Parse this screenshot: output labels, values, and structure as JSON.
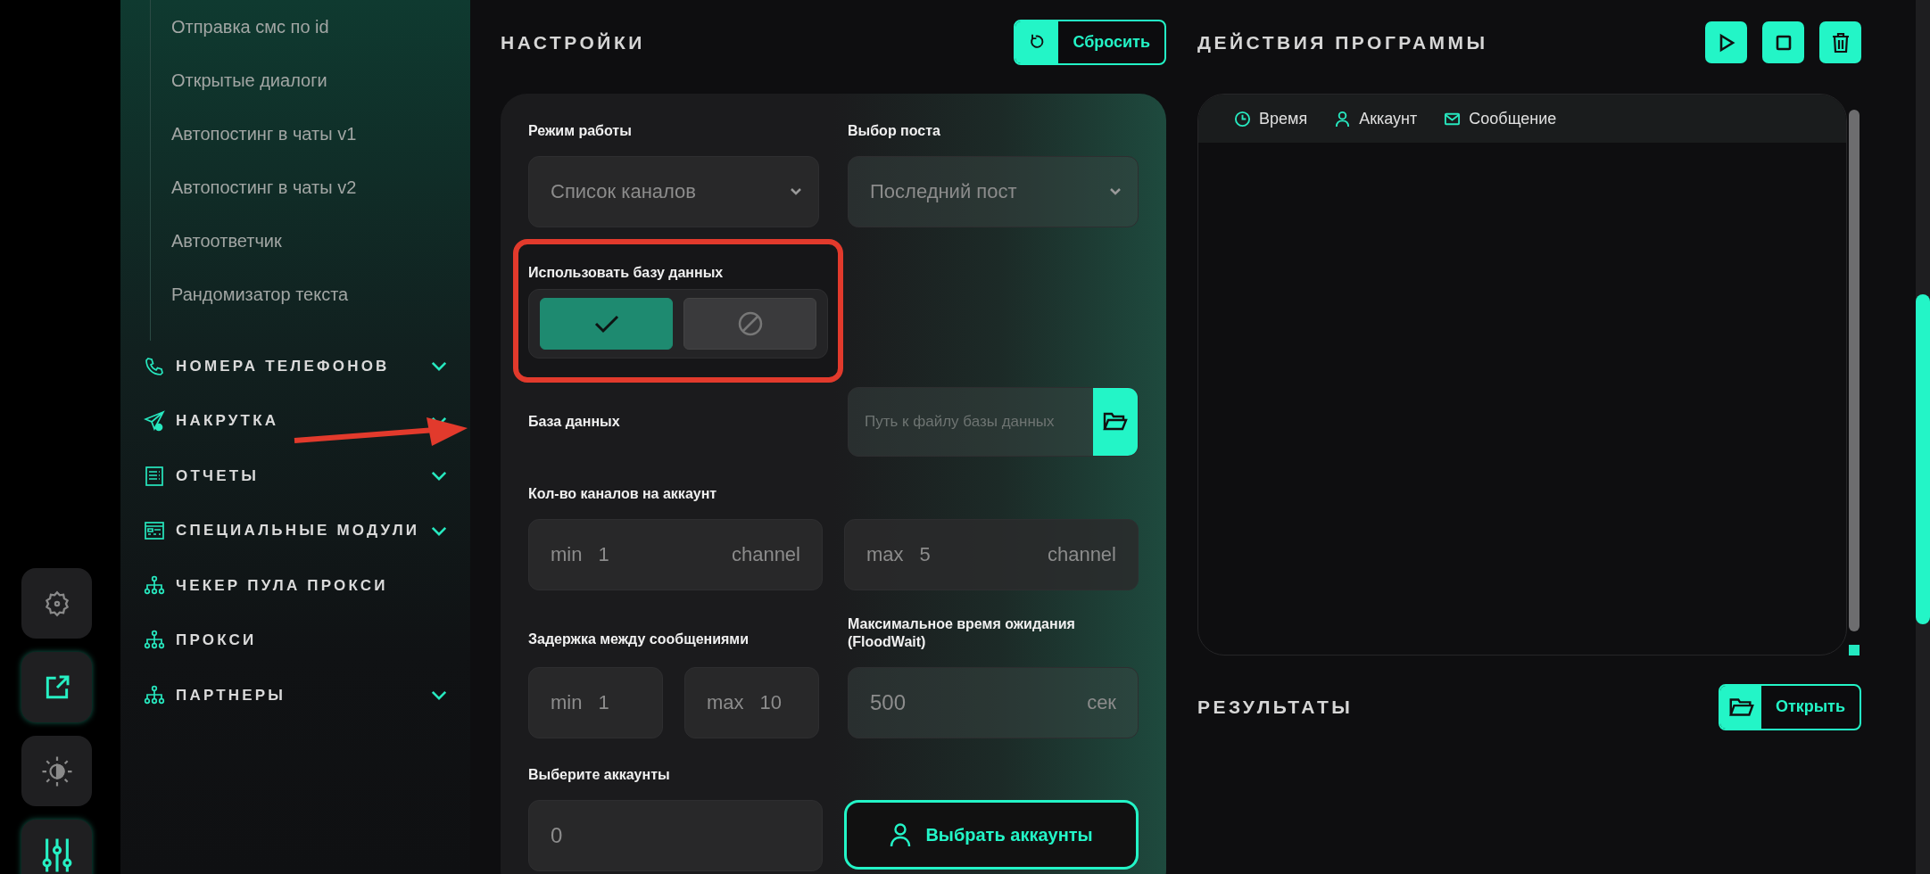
{
  "rail": [
    {
      "kind": "gear",
      "selected": false
    },
    {
      "kind": "share",
      "selected": true
    },
    {
      "kind": "theme",
      "selected": false
    },
    {
      "kind": "sliders",
      "selected": true
    }
  ],
  "sidebar": {
    "subitems": [
      "Отправка смс по id",
      "Открытые диалоги",
      "Автопостинг в чаты v1",
      "Автопостинг в чаты v2",
      "Автоответчик",
      "Рандомизатор текста"
    ],
    "sections": [
      {
        "kind": "phone",
        "label": "НОМЕРА ТЕЛЕФОНОВ",
        "expandable": true
      },
      {
        "kind": "plane",
        "label": "НАКРУТКА",
        "expandable": true
      },
      {
        "kind": "report",
        "label": "ОТЧЕТЫ",
        "expandable": true
      },
      {
        "kind": "modules",
        "label": "СПЕЦИАЛЬНЫЕ МОДУЛИ",
        "expandable": true
      },
      {
        "kind": "network",
        "label": "ЧЕКЕР ПУЛА ПРОКСИ",
        "expandable": false
      },
      {
        "kind": "network",
        "label": "ПРОКСИ",
        "expandable": false
      },
      {
        "kind": "network",
        "label": "ПАРТНЕРЫ",
        "expandable": true
      }
    ]
  },
  "settings": {
    "title": "НАСТРОЙКИ",
    "reset_button": "Сбросить",
    "mode": {
      "label": "Режим работы",
      "value": "Список каналов"
    },
    "post": {
      "label": "Выбор поста",
      "value": "Последний пост"
    },
    "use_db": {
      "label": "Использовать базу данных",
      "options": [
        {
          "kind": "check",
          "selected": true
        },
        {
          "kind": "ban",
          "selected": false
        }
      ]
    },
    "database": {
      "label": "База данных",
      "placeholder": "Путь к файлу базы данных"
    },
    "channels": {
      "label": "Кол-во каналов на аккаунт",
      "fields": [
        {
          "prefix": "min",
          "value": "1",
          "unit": "channel"
        },
        {
          "prefix": "max",
          "value": "5",
          "unit": "channel"
        }
      ]
    },
    "delay": {
      "label": "Задержка между сообщениями",
      "fields": [
        {
          "prefix": "min",
          "value": "1"
        },
        {
          "prefix": "max",
          "value": "10"
        }
      ]
    },
    "floodwait": {
      "label": "Максимальное время ожидания (FloodWait)",
      "value": "500",
      "unit": "сек"
    },
    "accounts": {
      "label": "Выберите аккаунты",
      "value": "0",
      "button": "Выбрать аккаунты"
    }
  },
  "actions": {
    "title": "ДЕЙСТВИЯ ПРОГРАММЫ",
    "buttons": [
      {
        "kind": "play"
      },
      {
        "kind": "stop"
      },
      {
        "kind": "delete"
      }
    ],
    "columns": [
      {
        "kind": "clock",
        "label": "Время"
      },
      {
        "kind": "user",
        "label": "Аккаунт"
      },
      {
        "kind": "mail",
        "label": "Сообщение"
      }
    ]
  },
  "results": {
    "title": "РЕЗУЛЬТАТЫ",
    "open_button": "Открыть"
  }
}
